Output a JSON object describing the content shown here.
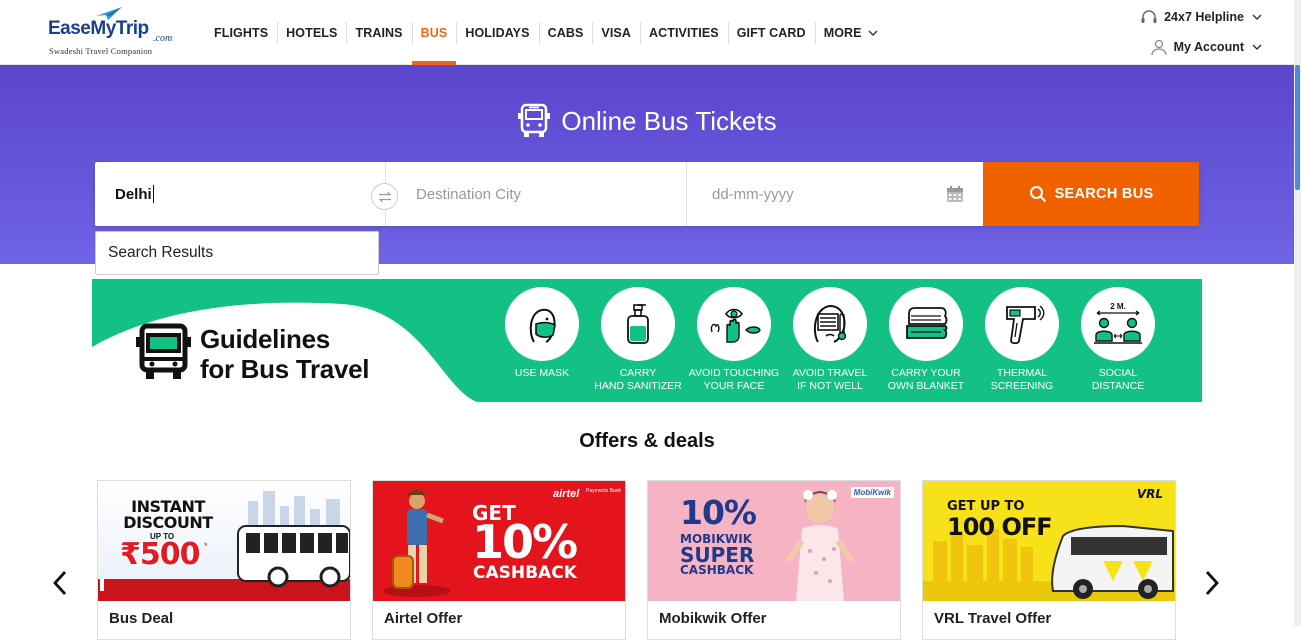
{
  "header": {
    "logo_main": "EaseMyTrip",
    "logo_com": ".com",
    "logo_tag": "Swadeshi Travel Companion",
    "nav": [
      "FLIGHTS",
      "HOTELS",
      "TRAINS",
      "BUS",
      "HOLIDAYS",
      "CABS",
      "VISA",
      "ACTIVITIES",
      "GIFT CARD",
      "MORE"
    ],
    "active_nav": "BUS",
    "helpline": "24x7 Helpline",
    "account": "My Account"
  },
  "hero": {
    "title": "Online Bus Tickets"
  },
  "search": {
    "from_value": "Delhi",
    "dest_placeholder": "Destination City",
    "date_placeholder": "dd-mm-yyyy",
    "button_label": "SEARCH BUS",
    "results_label": "Search Results"
  },
  "guidelines": {
    "title_line1": "Guidelines",
    "title_line2": "for Bus Travel",
    "items": [
      {
        "icon": "mask-icon",
        "label": "USE MASK"
      },
      {
        "icon": "sanitizer-icon",
        "label": "CARRY\nHAND SANITIZER"
      },
      {
        "icon": "no-touch-face-icon",
        "label": "AVOID TOUCHING\nYOUR FACE"
      },
      {
        "icon": "unwell-icon",
        "label": "AVOID TRAVEL\nIF NOT WELL"
      },
      {
        "icon": "blanket-icon",
        "label": "CARRY YOUR\nOWN BLANKET"
      },
      {
        "icon": "thermal-scanner-icon",
        "label": "THERMAL\nSCREENING"
      },
      {
        "icon": "social-distance-icon",
        "label": "SOCIAL\nDISTANCE",
        "badge": "2 M."
      }
    ]
  },
  "offers": {
    "title": "Offers & deals",
    "cards": [
      {
        "label": "Bus Deal",
        "line1": "INSTANT",
        "line2": "DISCOUNT",
        "line3": "UP TO",
        "amount": "₹500",
        "star": "*"
      },
      {
        "label": "Airtel Offer",
        "brand": "airtel",
        "brand_sub": "Payments Bank",
        "line1": "GET",
        "big": "10%",
        "line2": "CASHBACK"
      },
      {
        "label": "Mobikwik Offer",
        "brand": "MobiKwik",
        "big": "10%",
        "line1": "MOBIKWIK",
        "line2": "SUPER",
        "line3": "CASHBACK"
      },
      {
        "label": "VRL Travel Offer",
        "brand": "VRL",
        "line1": "GET UP TO",
        "line2": "100 OFF"
      }
    ]
  },
  "colors": {
    "accent": "#ef6614",
    "hero_top": "#5b45cc",
    "hero_bottom": "#6f63e6",
    "search_button": "#f26100",
    "guideline_green": "#13c185"
  }
}
